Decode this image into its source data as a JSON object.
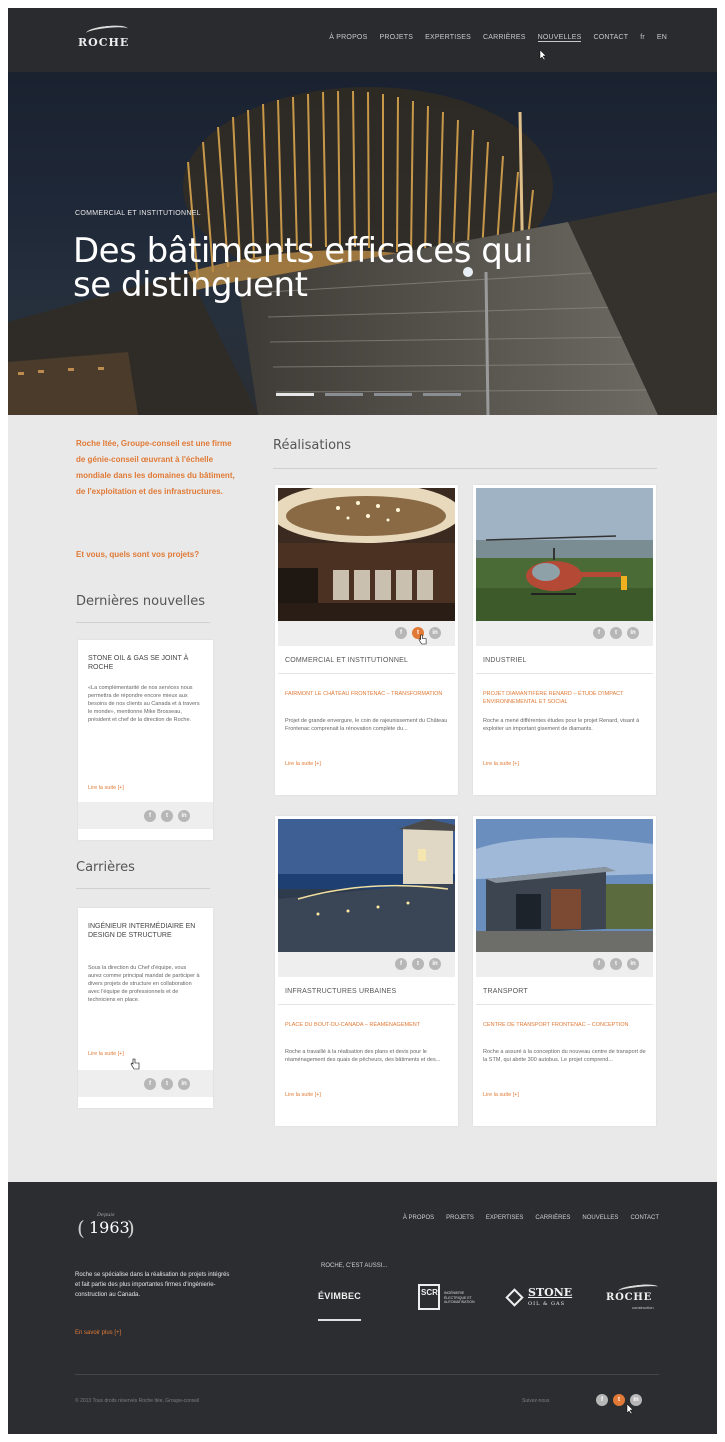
{
  "nav": {
    "logo_text": "ROCHE",
    "items": [
      "À PROPOS",
      "PROJETS",
      "EXPERTISES",
      "CARRIÈRES",
      "NOUVELLES",
      "CONTACT",
      "fr",
      "EN"
    ],
    "active_index": 4
  },
  "hero": {
    "kicker": "COMMERCIAL ET INSTITUTIONNEL",
    "title": "Des bâtiments efficaces qui se distinguent",
    "slides": 4,
    "active_slide": 0
  },
  "intro": {
    "text": "Roche ltée, Groupe-conseil est une firme de génie-conseil œuvrant à l'échelle mondiale dans les domaines du bâtiment, de l'exploitation et des infrastructures.",
    "cta": "Et vous, quels sont vos projets?"
  },
  "news": {
    "heading": "Dernières nouvelles",
    "title": "STONE OIL & GAS SE JOINT À ROCHE",
    "body": "«La complémentarité de nos services nous permettra de répondre encore mieux aux besoins de nos clients au Canada et à travers le monde», mentionne Mike Brosseau, président et chef de la direction de Roche.",
    "more": "Lire la suite [+]"
  },
  "careers": {
    "heading": "Carrières",
    "title": "INGÉNIEUR INTERMÉDIAIRE EN DESIGN DE STRUCTURE",
    "body": "Sous la direction du Chef d'équipe, vous aurez comme principal mandat de participer à divers projets de structure en collaboration avec l'équipe de professionnels et de techniciens en place.",
    "more": "Lire la suite [+]"
  },
  "realisations": {
    "heading": "Réalisations",
    "projects": [
      {
        "category": "COMMERCIAL ET INSTITUTIONNEL",
        "title": "FAIRMONT LE CHÂTEAU FRONTENAC – TRANSFORMATION",
        "body": "Projet de grande envergure, le coin de rajeunissement du Château Frontenac comprenait la rénovation complète du...",
        "more": "Lire la suite [+]",
        "image": "hotel-lobby"
      },
      {
        "category": "INDUSTRIEL",
        "title": "PROJET DIAMANTIFÈRE RENARD – ÉTUDE D'IMPACT ENVIRONNEMENTAL ET SOCIAL",
        "body": "Roche a mené différentes études pour le projet Renard, visant à exploiter un important gisement de diamants.",
        "more": "Lire la suite [+]",
        "image": "helicopter"
      },
      {
        "category": "INFRASTRUCTURES URBAINES",
        "title": "PLACE DU BOUT-DU-CANADA – RÉAMÉNAGEMENT",
        "body": "Roche a travaillé à la réalisation des plans et devis pour le réaménagement des quais de pêcheurs, des bâtiments et des...",
        "more": "Lire la suite [+]",
        "image": "waterfront-night"
      },
      {
        "category": "TRANSPORT",
        "title": "CENTRE DE TRANSPORT FRONTENAC – CONCEPTION",
        "body": "Roche a assuré à la conception du nouveau centre de transport de la STM, qui abrite 300 autobus. Le projet comprend...",
        "more": "Lire la suite [+]",
        "image": "bus-garage"
      }
    ]
  },
  "footer": {
    "since_label": "Depuis",
    "since_year": "1963",
    "about": "Roche se spécialise dans la réalisation de projets intégrés et fait partie des plus importantes firmes d'ingénierie-construction au Canada.",
    "more": "En savoir plus [+]",
    "menu": [
      "À PROPOS",
      "PROJETS",
      "EXPERTISES",
      "CARRIÈRES",
      "NOUVELLES",
      "CONTACT"
    ],
    "also_label": "ROCHE, C'EST AUSSI...",
    "brands": [
      "ÉVIMBEC",
      "SCR",
      "STONE",
      "ROCHE"
    ],
    "brand_sub": {
      "scr": "INGÉNIERIE ÉLECTRIQUE ET AUTOMATISATION",
      "stone": "OIL & GAS",
      "roche": "construction"
    },
    "copyright": "© 2013 Tous droits réservés Roche ltée, Groupe-conseil",
    "follow": "Suivez-nous"
  },
  "colors": {
    "accent": "#e07a36",
    "nav_bg": "#2a2b2e",
    "footer_bg": "#2c2d31",
    "page_bg": "#e9e9e9"
  }
}
